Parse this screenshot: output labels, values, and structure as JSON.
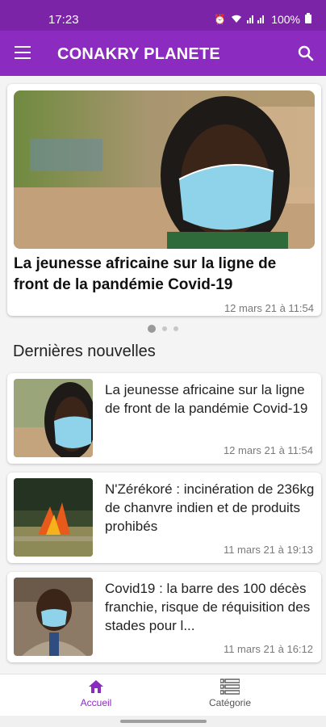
{
  "status_bar": {
    "time": "17:23",
    "battery": "100%"
  },
  "app_bar": {
    "title": "CONAKRY PLANETE",
    "menu_icon": "hamburger-menu-icon",
    "search_icon": "search-icon"
  },
  "featured": {
    "title": "La jeunesse africaine sur la ligne de front de la pandémie Covid-19",
    "date": "12 mars 21 à 11:54"
  },
  "pager": {
    "count": 3,
    "active": 0
  },
  "section_title": "Dernières nouvelles",
  "news": [
    {
      "title": "La jeunesse africaine sur la ligne de front de la pandémie Covid-19",
      "date": "12 mars 21 à 11:54"
    },
    {
      "title": "N'Zérékoré : incinération de 236kg de chanvre indien et de produits prohibés",
      "date": "11 mars 21 à 19:13"
    },
    {
      "title": "Covid19 : la barre des 100 décès franchie, risque de réquisition des stades pour l...",
      "date": "11 mars 21 à 16:12"
    }
  ],
  "bottom_nav": {
    "home_label": "Accueil",
    "category_label": "Catégorie",
    "active": "home"
  },
  "colors": {
    "primary": "#8c2bbf",
    "status_bar": "#7b24a8"
  }
}
